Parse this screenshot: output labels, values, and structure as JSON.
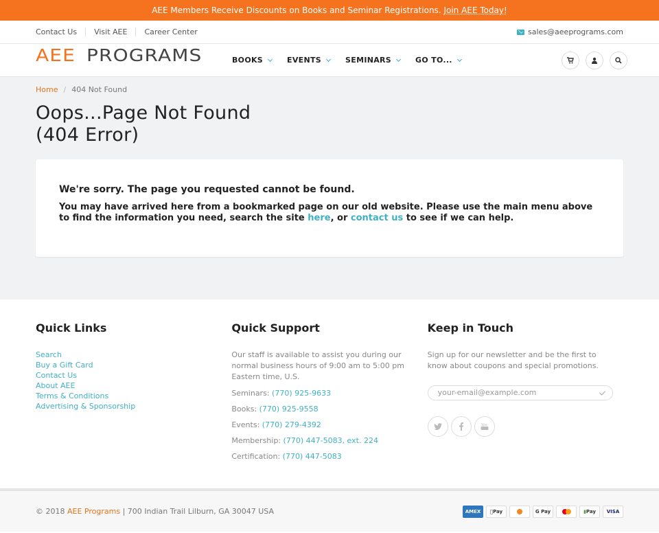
{
  "promo": {
    "text": "AEE Members Receive Discounts on Books and Seminar Registrations. ",
    "link": "Join AEE Today!"
  },
  "top_links": {
    "items": [
      "Contact Us",
      "Visit AEE",
      "Career Center"
    ],
    "email": "sales@aeeprograms.com"
  },
  "logo": {
    "part1": "AEE",
    "part2": "PROGRAMS"
  },
  "nav": {
    "items": [
      "BOOKS",
      "EVENTS",
      "SEMINARS",
      "GO TO..."
    ]
  },
  "header_icons": [
    "cart-icon",
    "user-icon",
    "search-icon"
  ],
  "breadcrumb": {
    "home": "Home",
    "current": "404 Not Found"
  },
  "page": {
    "title": "Oops...Page Not Found (404 Error)",
    "sorry": "We're sorry. The page you requested cannot be found.",
    "msg_before": "You may have arrived here from a bookmarked page on our old website. Please use the main menu above to find the information you need, search the site ",
    "link_here": "here",
    "msg_mid": ", or ",
    "link_contact": "contact us",
    "msg_after": " to see if we can help."
  },
  "footer": {
    "quick_links": {
      "heading": "Quick Links",
      "items": [
        "Search",
        "Buy a Gift Card",
        "Contact Us",
        "About AEE",
        "Terms & Conditions",
        "Advertising & Sponsorship"
      ]
    },
    "quick_support": {
      "heading": "Quick Support",
      "intro": "Our staff is available to assist you during our normal business hours of 9:00 am to 5:00 pm Eastern time, U.S.",
      "lines": [
        {
          "label": "Seminars: ",
          "phone": "(770) 925-9633"
        },
        {
          "label": "Books: ",
          "phone": "(770) 925-9558"
        },
        {
          "label": "Events: ",
          "phone": "(770) 279-4392"
        },
        {
          "label": "Membership: ",
          "phone": "(770) 447-5083, ext. 224"
        },
        {
          "label": "Certification: ",
          "phone": "(770) 447-5083"
        }
      ]
    },
    "keep_in_touch": {
      "heading": "Keep in Touch",
      "text": "Sign up for our newsletter and be the first to know about coupons and special promotions.",
      "email_placeholder": "your-email@example.com",
      "social": [
        "twitter-icon",
        "facebook-icon",
        "youtube-icon"
      ]
    }
  },
  "bottom": {
    "copy_prefix": "© 2018 ",
    "brand": "AEE Programs",
    "address": " | 700 Indian Trail Lilburn, GA 30047 USA",
    "payments": [
      "AMEX",
      "Pay",
      "",
      "G Pay",
      "",
      "Pay",
      "VISA"
    ]
  },
  "colors": {
    "orange": "#f5721e",
    "teal": "#3fb1c4"
  }
}
